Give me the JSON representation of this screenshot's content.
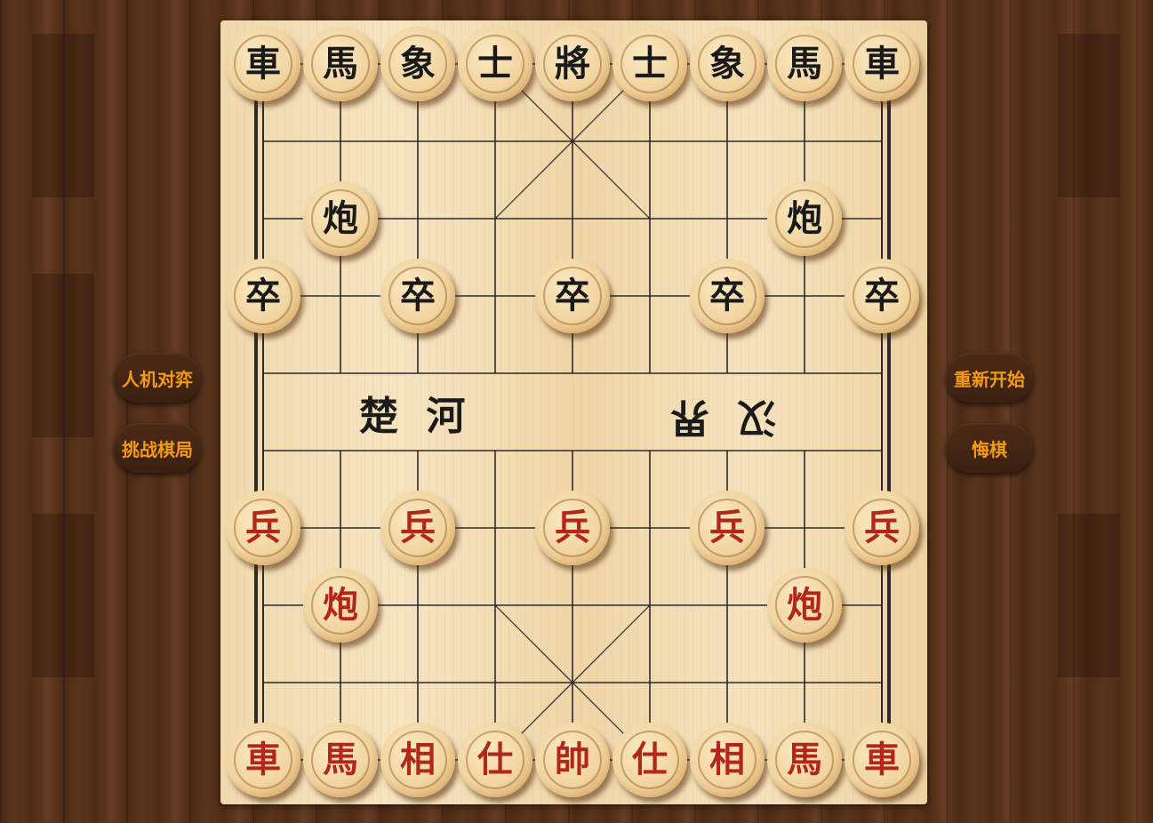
{
  "river": {
    "left_text": "楚 河",
    "right_text": "汉 界"
  },
  "left_buttons": [
    {
      "label": "人机对弈"
    },
    {
      "label": "挑战棋局"
    }
  ],
  "right_buttons": [
    {
      "label": "重新开始"
    },
    {
      "label": "悔棋"
    }
  ],
  "colors": {
    "button_text": "#f59a17",
    "red_piece_text": "#b3271b",
    "black_piece_text": "#1a1a1a",
    "board_line": "#2b2b2b"
  },
  "board": {
    "files": 9,
    "ranks": 10,
    "pieces": [
      {
        "side": "black",
        "char": "車",
        "file": 0,
        "rank": 0
      },
      {
        "side": "black",
        "char": "馬",
        "file": 1,
        "rank": 0
      },
      {
        "side": "black",
        "char": "象",
        "file": 2,
        "rank": 0
      },
      {
        "side": "black",
        "char": "士",
        "file": 3,
        "rank": 0
      },
      {
        "side": "black",
        "char": "將",
        "file": 4,
        "rank": 0
      },
      {
        "side": "black",
        "char": "士",
        "file": 5,
        "rank": 0
      },
      {
        "side": "black",
        "char": "象",
        "file": 6,
        "rank": 0
      },
      {
        "side": "black",
        "char": "馬",
        "file": 7,
        "rank": 0
      },
      {
        "side": "black",
        "char": "車",
        "file": 8,
        "rank": 0
      },
      {
        "side": "black",
        "char": "炮",
        "file": 1,
        "rank": 2
      },
      {
        "side": "black",
        "char": "炮",
        "file": 7,
        "rank": 2
      },
      {
        "side": "black",
        "char": "卒",
        "file": 0,
        "rank": 3
      },
      {
        "side": "black",
        "char": "卒",
        "file": 2,
        "rank": 3
      },
      {
        "side": "black",
        "char": "卒",
        "file": 4,
        "rank": 3
      },
      {
        "side": "black",
        "char": "卒",
        "file": 6,
        "rank": 3
      },
      {
        "side": "black",
        "char": "卒",
        "file": 8,
        "rank": 3
      },
      {
        "side": "red",
        "char": "兵",
        "file": 0,
        "rank": 6
      },
      {
        "side": "red",
        "char": "兵",
        "file": 2,
        "rank": 6
      },
      {
        "side": "red",
        "char": "兵",
        "file": 4,
        "rank": 6
      },
      {
        "side": "red",
        "char": "兵",
        "file": 6,
        "rank": 6
      },
      {
        "side": "red",
        "char": "兵",
        "file": 8,
        "rank": 6
      },
      {
        "side": "red",
        "char": "炮",
        "file": 1,
        "rank": 7
      },
      {
        "side": "red",
        "char": "炮",
        "file": 7,
        "rank": 7
      },
      {
        "side": "red",
        "char": "車",
        "file": 0,
        "rank": 9
      },
      {
        "side": "red",
        "char": "馬",
        "file": 1,
        "rank": 9
      },
      {
        "side": "red",
        "char": "相",
        "file": 2,
        "rank": 9
      },
      {
        "side": "red",
        "char": "仕",
        "file": 3,
        "rank": 9
      },
      {
        "side": "red",
        "char": "帥",
        "file": 4,
        "rank": 9
      },
      {
        "side": "red",
        "char": "仕",
        "file": 5,
        "rank": 9
      },
      {
        "side": "red",
        "char": "相",
        "file": 6,
        "rank": 9
      },
      {
        "side": "red",
        "char": "馬",
        "file": 7,
        "rank": 9
      },
      {
        "side": "red",
        "char": "車",
        "file": 8,
        "rank": 9
      }
    ]
  }
}
